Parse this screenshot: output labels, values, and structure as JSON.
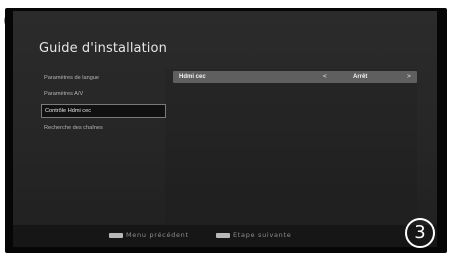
{
  "screen": {
    "title": "Guide d'installation"
  },
  "menu": {
    "items": [
      {
        "label": "Paramètres de langue",
        "selected": false
      },
      {
        "label": "Paramètres A/V",
        "selected": false
      },
      {
        "label": "Contrôle Hdmi cec",
        "selected": true
      },
      {
        "label": "Recherche des chaînes",
        "selected": false
      }
    ]
  },
  "option": {
    "label": "Hdmi cec",
    "value": "Arrêt",
    "left_arrow": "<",
    "right_arrow": ">"
  },
  "footer": {
    "prev_label": "Menu précédent",
    "next_label": "Etape suivante",
    "prev_key_color": "#b8b8b8",
    "next_key_color": "#b8b8b8"
  },
  "step_badge": "3",
  "logo_icon": "head-outline-icon"
}
